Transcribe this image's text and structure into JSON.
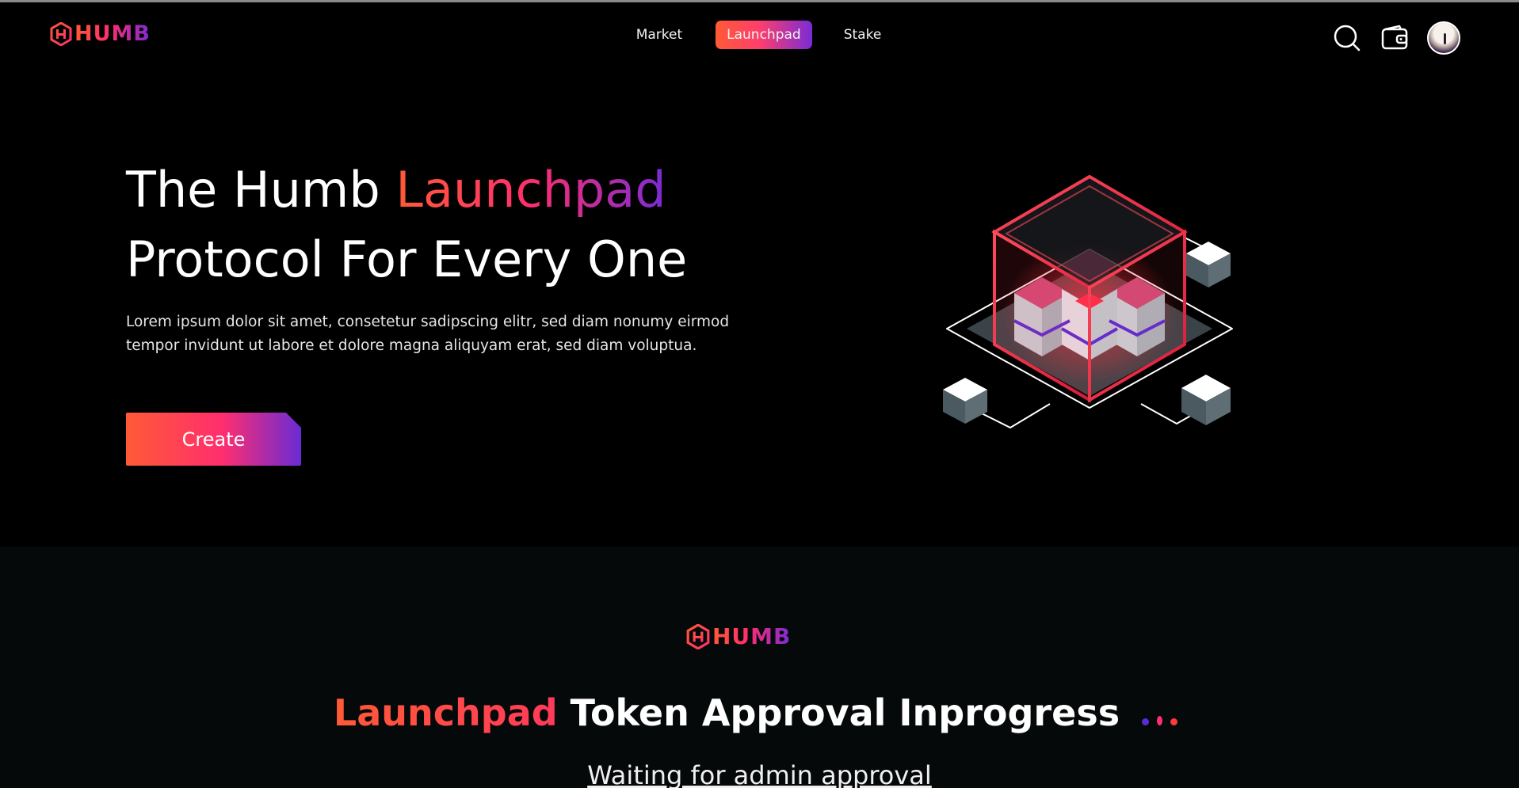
{
  "header": {
    "logo_text": "HUMB",
    "nav": [
      {
        "label": "Market",
        "active": false
      },
      {
        "label": "Launchpad",
        "active": true
      },
      {
        "label": "Stake",
        "active": false
      }
    ],
    "icons": [
      "search-icon",
      "wallet-icon",
      "avatar"
    ]
  },
  "hero": {
    "title_part1": "The Humb ",
    "title_highlight": "Launchpad",
    "title_line2": "Protocol For Every One",
    "description": "Lorem ipsum dolor sit amet, consetetur sadipscing elitr, sed diam nonumy eirmod tempor invidunt ut labore et dolore magna aliquyam erat, sed diam voluptua.",
    "create_label": "Create"
  },
  "status": {
    "logo_text": "HUMB",
    "title_highlight": "Launchpad",
    "title_rest": " Token Approval Inprogress",
    "waiting_text": "Waiting for admin approval"
  },
  "colors": {
    "accent_orange": "#ff5a36",
    "accent_pink": "#ff2e6e",
    "accent_purple": "#7a2bd6",
    "background": "#000000"
  }
}
